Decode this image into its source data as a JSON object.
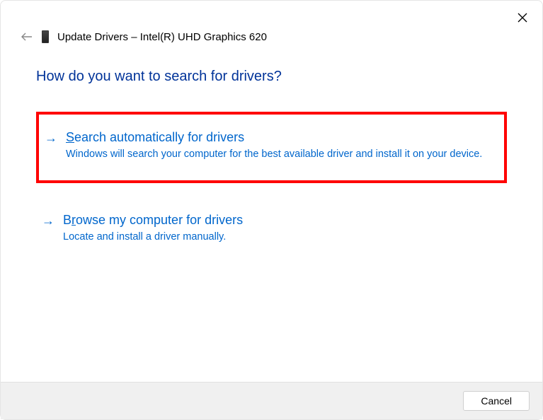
{
  "header": {
    "title": "Update Drivers – Intel(R) UHD Graphics 620"
  },
  "prompt": "How do you want to search for drivers?",
  "options": [
    {
      "accelerator": "S",
      "title_rest": "earch automatically for drivers",
      "description": "Windows will search your computer for the best available driver and install it on your device.",
      "highlighted": true
    },
    {
      "accelerator_prefix": "B",
      "accelerator": "r",
      "title_rest": "owse my computer for drivers",
      "description": "Locate and install a driver manually.",
      "highlighted": false
    }
  ],
  "footer": {
    "cancel": "Cancel"
  }
}
